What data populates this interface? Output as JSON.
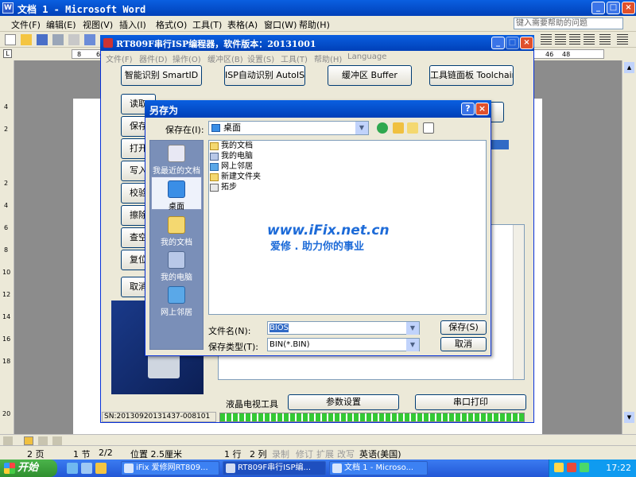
{
  "word": {
    "title": "文档 1 - Microsoft Word",
    "menu": [
      "文件(F)",
      "编辑(E)",
      "视图(V)",
      "插入(I)",
      "格式(O)",
      "工具(T)",
      "表格(A)",
      "窗口(W)",
      "帮助(H)"
    ],
    "help_placeholder": "键入需要帮助的问题",
    "ruler_numbers": [
      "8",
      "6",
      "46",
      "48"
    ],
    "left_ruler_numbers": [
      "4",
      "2",
      "2",
      "4",
      "6",
      "8",
      "10",
      "12",
      "14",
      "16",
      "18",
      "20"
    ],
    "status": {
      "page": "2 页",
      "section": "1 节",
      "pages": "2/2",
      "position": "位置 2.5厘米",
      "line": "1 行",
      "col": "2 列",
      "rec": "录制",
      "trk": "修订",
      "ext": "扩展",
      "ovr": "改写",
      "lang": "英语(美国)"
    }
  },
  "isp": {
    "title": "RT809F串行ISP编程器，软件版本：20131001",
    "menu": [
      "文件(F)",
      "器件(D)",
      "操作(O)",
      "缓冲区(B)",
      "设置(S)",
      "工具(T)",
      "帮助(H)",
      "Language"
    ],
    "buttons": {
      "smartid": "智能识别 SmartID",
      "autoisp": "ISP自动识别 AutoISP",
      "buffer": "缓冲区 Buffer",
      "toolchain": "工具链面板 Toolchain",
      "read": "读取",
      "save": "保存",
      "open": "打开",
      "write": "写入",
      "verify": "校验",
      "erase": "擦除",
      "check": "查空",
      "reset": "复位",
      "cancel": "取消",
      "params": "参数设置",
      "serial": "串口打印"
    },
    "lcd_tool": "液晶电视工具",
    "sn": "SN:20130920131437-008101",
    "progress_percent": 100
  },
  "dialog": {
    "title": "另存为",
    "help_btn": "?",
    "close_btn": "×",
    "save_in_label": "保存在(I):",
    "save_in_value": "桌面",
    "places": [
      "我最近的文档",
      "桌面",
      "我的文档",
      "我的电脑",
      "网上邻居"
    ],
    "files": [
      "我的文档",
      "我的电脑",
      "网上邻居",
      "新建文件夹",
      "拓步"
    ],
    "filename_label": "文件名(N):",
    "filename_value": "BIOS",
    "filetype_label": "保存类型(T):",
    "filetype_value": "BIN(*.BIN)",
    "save_button": "保存(S)",
    "cancel_button": "取消"
  },
  "watermark": {
    "line1": "www.iFix.net.cn",
    "line2": "爱修 . 助力你的事业"
  },
  "taskbar": {
    "start": "开始",
    "tasks": [
      "iFix 爱修网RT809...",
      "RT809F串行ISP编...",
      "文档 1 - Microso..."
    ],
    "clock": "17:22"
  }
}
